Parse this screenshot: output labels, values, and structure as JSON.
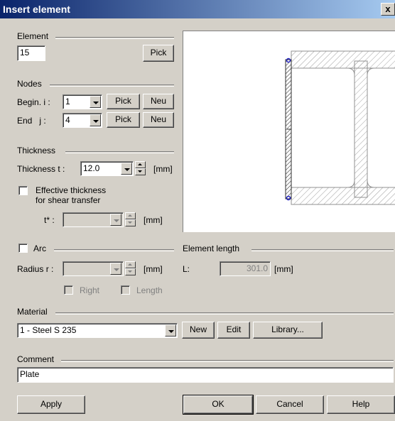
{
  "window": {
    "title": "Insert element",
    "close_label": "x"
  },
  "element": {
    "group_label": "Element",
    "value": "15",
    "pick_label": "Pick"
  },
  "nodes": {
    "group_label": "Nodes",
    "begin_label": "Begin. i :",
    "begin_value": "1",
    "end_label": "End   j :",
    "end_value": "4",
    "pick_label": "Pick",
    "new_label": "Neu"
  },
  "thickness": {
    "group_label": "Thickness",
    "label": "Thickness  t :",
    "value": "12.0",
    "unit": "[mm]",
    "effective_label_1": "Effective thickness",
    "effective_label_2": "for shear transfer",
    "tstar_label": "t* :",
    "tstar_unit": "[mm]"
  },
  "arc": {
    "label": "Arc",
    "radius_label": "Radius r :",
    "radius_unit": "[mm]",
    "right_label": "Right",
    "length_label": "Length"
  },
  "element_length": {
    "group_label": "Element length",
    "label": "L:",
    "value": "301.0",
    "unit": "[mm]"
  },
  "material": {
    "group_label": "Material",
    "selected": "1 - Steel S 235",
    "new_label": "New",
    "edit_label": "Edit",
    "library_label": "Library..."
  },
  "comment": {
    "group_label": "Comment",
    "value": "Plate"
  },
  "buttons": {
    "apply": "Apply",
    "ok": "OK",
    "cancel": "Cancel",
    "help": "Help"
  },
  "icons": {
    "dropdown": "chevron-down-icon",
    "spin": "spin-arrows-icon"
  },
  "colors": {
    "titlebar_start": "#0a246a",
    "titlebar_end": "#a6caf0",
    "face": "#d4d0c8",
    "highlight_element": "#2020c0"
  }
}
